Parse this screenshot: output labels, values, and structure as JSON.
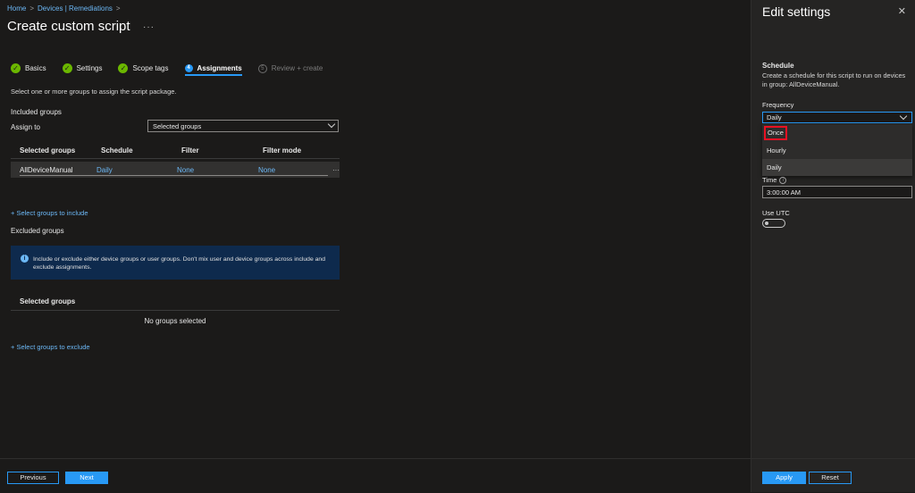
{
  "breadcrumb": {
    "home": "Home",
    "sep": ">",
    "devices": "Devices | Remediations"
  },
  "page": {
    "title": "Create custom script",
    "more": "···"
  },
  "steps": [
    {
      "label": "Basics",
      "state": "done"
    },
    {
      "label": "Settings",
      "state": "done"
    },
    {
      "label": "Scope tags",
      "state": "done"
    },
    {
      "label": "Assignments",
      "number": "4",
      "state": "active"
    },
    {
      "label": "Review + create",
      "number": "5",
      "state": "pending"
    }
  ],
  "assignments": {
    "intro": "Select one or more groups to assign the script package.",
    "included_label": "Included groups",
    "assign_to_label": "Assign to",
    "assign_to_value": "Selected groups",
    "columns": [
      "Selected groups",
      "Schedule",
      "Filter",
      "Filter mode"
    ],
    "rows": [
      {
        "group": "AllDeviceManual",
        "schedule": "Daily",
        "filter": "None",
        "filter_mode": "None"
      }
    ],
    "row_more": "···",
    "include_link": "+ Select groups to include",
    "excluded_label": "Excluded groups",
    "info": "Include or exclude either device groups or user groups. Don't mix user and device groups across include and exclude assignments.",
    "excluded_column": "Selected groups",
    "no_groups": "No groups selected",
    "exclude_link": "+ Select groups to exclude"
  },
  "footer": {
    "previous": "Previous",
    "next": "Next"
  },
  "panel": {
    "title": "Edit settings",
    "close": "✕",
    "schedule_title": "Schedule",
    "schedule_desc": "Create a schedule for this script to run on devices in group: AllDeviceManual.",
    "frequency_label": "Frequency",
    "frequency_value": "Daily",
    "frequency_options": [
      "Once",
      "Hourly",
      "Daily"
    ],
    "time_label": "Time",
    "time_value": "3:00:00 AM",
    "utc_label": "Use UTC",
    "use_utc": false,
    "apply": "Apply",
    "reset": "Reset"
  },
  "colors": {
    "accent": "#2899f5",
    "success": "#6bb700",
    "highlight": "#e81123",
    "info_bg": "#0e2a4d"
  }
}
